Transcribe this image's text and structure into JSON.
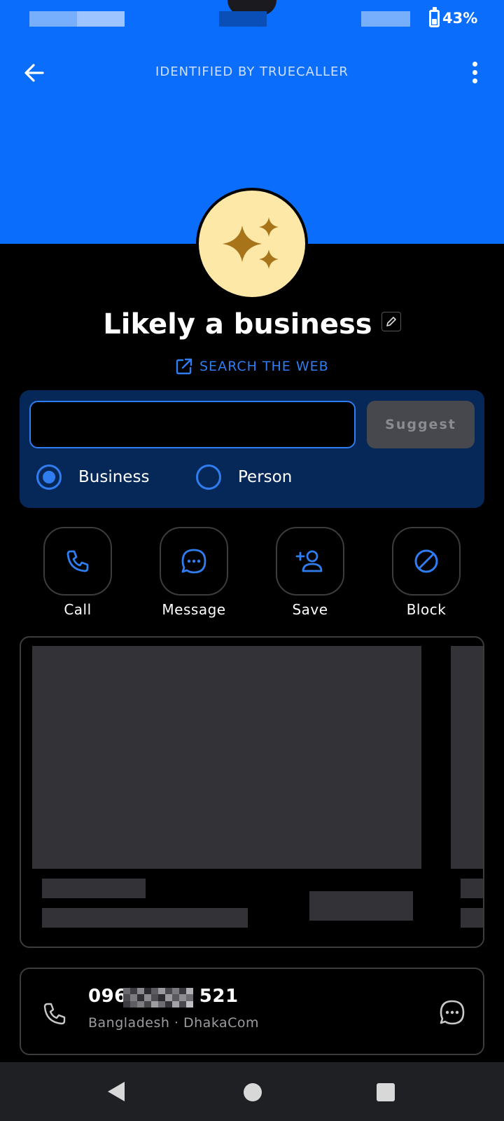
{
  "status_bar": {
    "battery_text": "43%",
    "battery_level": 0.43
  },
  "header": {
    "title": "IDENTIFIED BY TRUECALLER",
    "back_icon": "arrow-left-icon",
    "menu_icon": "more-vert-icon"
  },
  "profile": {
    "name": "Likely a business",
    "avatar_icon": "sparkles-icon",
    "search_web_label": "SEARCH THE WEB"
  },
  "suggest": {
    "input_value": "",
    "button_label": "Suggest",
    "options": [
      {
        "label": "Business",
        "selected": true
      },
      {
        "label": "Person",
        "selected": false
      }
    ]
  },
  "actions": [
    {
      "label": "Call",
      "icon": "phone-icon"
    },
    {
      "label": "Message",
      "icon": "message-icon"
    },
    {
      "label": "Save",
      "icon": "add-contact-icon"
    },
    {
      "label": "Block",
      "icon": "block-icon"
    }
  ],
  "number": {
    "prefix": "096",
    "suffix": "521",
    "subtitle": "Bangladesh · DhakaCom"
  },
  "colors": {
    "accent": "#0a6dfc",
    "link": "#2f7df0",
    "card": "#062858",
    "avatar": "#fde8a8",
    "star": "#a8741a"
  }
}
